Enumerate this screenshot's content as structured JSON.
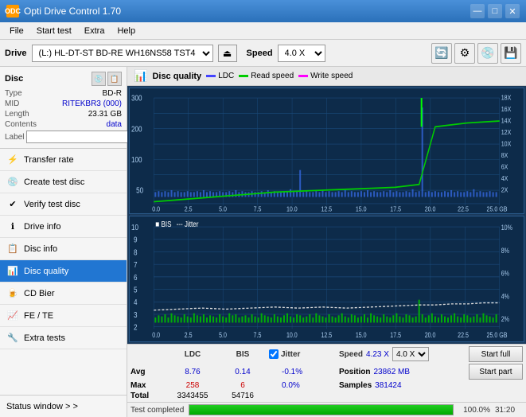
{
  "app": {
    "title": "Opti Drive Control 1.70",
    "icon": "ODC"
  },
  "title_controls": {
    "minimize": "—",
    "maximize": "□",
    "close": "✕"
  },
  "menu": {
    "items": [
      "File",
      "Start test",
      "Extra",
      "Help"
    ]
  },
  "drive_bar": {
    "label": "Drive",
    "drive_value": "(L:)  HL-DT-ST BD-RE  WH16NS58 TST4",
    "speed_label": "Speed",
    "speed_value": "4.0 X"
  },
  "disc": {
    "title": "Disc",
    "type_label": "Type",
    "type_value": "BD-R",
    "mid_label": "MID",
    "mid_value": "RITEKBR3 (000)",
    "length_label": "Length",
    "length_value": "23.31 GB",
    "contents_label": "Contents",
    "contents_value": "data",
    "label_label": "Label",
    "label_value": ""
  },
  "nav_items": [
    {
      "id": "transfer-rate",
      "label": "Transfer rate",
      "icon": "⚡"
    },
    {
      "id": "create-test-disc",
      "label": "Create test disc",
      "icon": "💿"
    },
    {
      "id": "verify-test-disc",
      "label": "Verify test disc",
      "icon": "✔"
    },
    {
      "id": "drive-info",
      "label": "Drive info",
      "icon": "ℹ"
    },
    {
      "id": "disc-info",
      "label": "Disc info",
      "icon": "📋"
    },
    {
      "id": "disc-quality",
      "label": "Disc quality",
      "icon": "📊",
      "active": true
    },
    {
      "id": "cd-bier",
      "label": "CD Bier",
      "icon": "🍺"
    },
    {
      "id": "fe-te",
      "label": "FE / TE",
      "icon": "📈"
    },
    {
      "id": "extra-tests",
      "label": "Extra tests",
      "icon": "🔧"
    }
  ],
  "status_window": {
    "label": "Status window > >"
  },
  "chart_header": {
    "title": "Disc quality",
    "legend": [
      {
        "label": "LDC",
        "color": "#4444ff"
      },
      {
        "label": "Read speed",
        "color": "#00ff00"
      },
      {
        "label": "Write speed",
        "color": "#ff00ff"
      }
    ]
  },
  "chart1": {
    "y_max": 300,
    "y_label_right": [
      "18X",
      "16X",
      "14X",
      "12X",
      "10X",
      "8X",
      "6X",
      "4X",
      "2X"
    ],
    "x_labels": [
      "0.0",
      "2.5",
      "5.0",
      "7.5",
      "10.0",
      "12.5",
      "15.0",
      "17.5",
      "20.0",
      "22.5",
      "25.0 GB"
    ]
  },
  "chart2": {
    "title": "BIS",
    "legend2": "Jitter",
    "y_max": 10,
    "y_label_right": [
      "10%",
      "8%",
      "6%",
      "4%",
      "2%"
    ],
    "x_labels": [
      "0.0",
      "2.5",
      "5.0",
      "7.5",
      "10.0",
      "12.5",
      "15.0",
      "17.5",
      "20.0",
      "22.5",
      "25.0 GB"
    ]
  },
  "stats": {
    "col_headers": [
      "LDC",
      "BIS",
      "",
      "Jitter",
      "Speed"
    ],
    "avg_label": "Avg",
    "avg_ldc": "8.76",
    "avg_bis": "0.14",
    "avg_jitter": "-0.1%",
    "max_label": "Max",
    "max_ldc": "258",
    "max_bis": "6",
    "max_jitter": "0.0%",
    "total_label": "Total",
    "total_ldc": "3343455",
    "total_bis": "54716",
    "speed_label": "Speed",
    "speed_value": "4.23 X",
    "speed_select": "4.0 X",
    "position_label": "Position",
    "position_value": "23862 MB",
    "samples_label": "Samples",
    "samples_value": "381424",
    "btn_start_full": "Start full",
    "btn_start_part": "Start part"
  },
  "progress": {
    "status_text": "Test completed",
    "percent": 100.0,
    "percent_display": "100.0%",
    "time": "31:20"
  }
}
